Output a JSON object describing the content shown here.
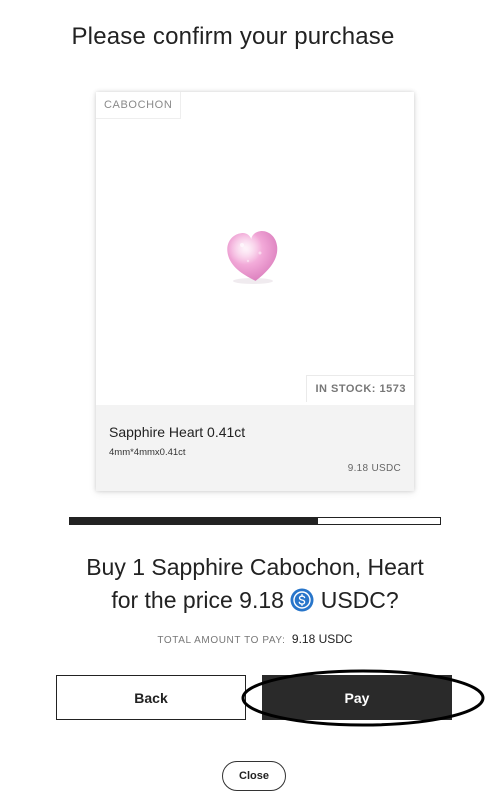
{
  "header": {
    "title": "Please confirm your purchase"
  },
  "product_card": {
    "tag": "CABOCHON",
    "stock_text": "IN STOCK: 1573",
    "name": "Sapphire Heart 0.41ct",
    "dimensions": "4mm*4mmx0.41ct",
    "price": "9.18 USDC",
    "image_icon": "pink-heart-gem"
  },
  "progress": {
    "fraction": 0.67
  },
  "confirmation": {
    "question_line1": "Buy 1 Sapphire Cabochon, Heart",
    "question_line2_prefix": "for the price 9.18",
    "currency_icon": "usdc-coin-icon",
    "question_line2_suffix": "USDC?",
    "total_label": "TOTAL AMOUNT TO PAY:",
    "total_value": "9.18 USDC"
  },
  "actions": {
    "back_label": "Back",
    "pay_label": "Pay",
    "close_label": "Close"
  },
  "colors": {
    "primary_dark": "#2a2a2a",
    "gem_pink": "#f0a8d6",
    "usdc_blue": "#2775ca",
    "card_footer_bg": "#f3f3f3"
  }
}
